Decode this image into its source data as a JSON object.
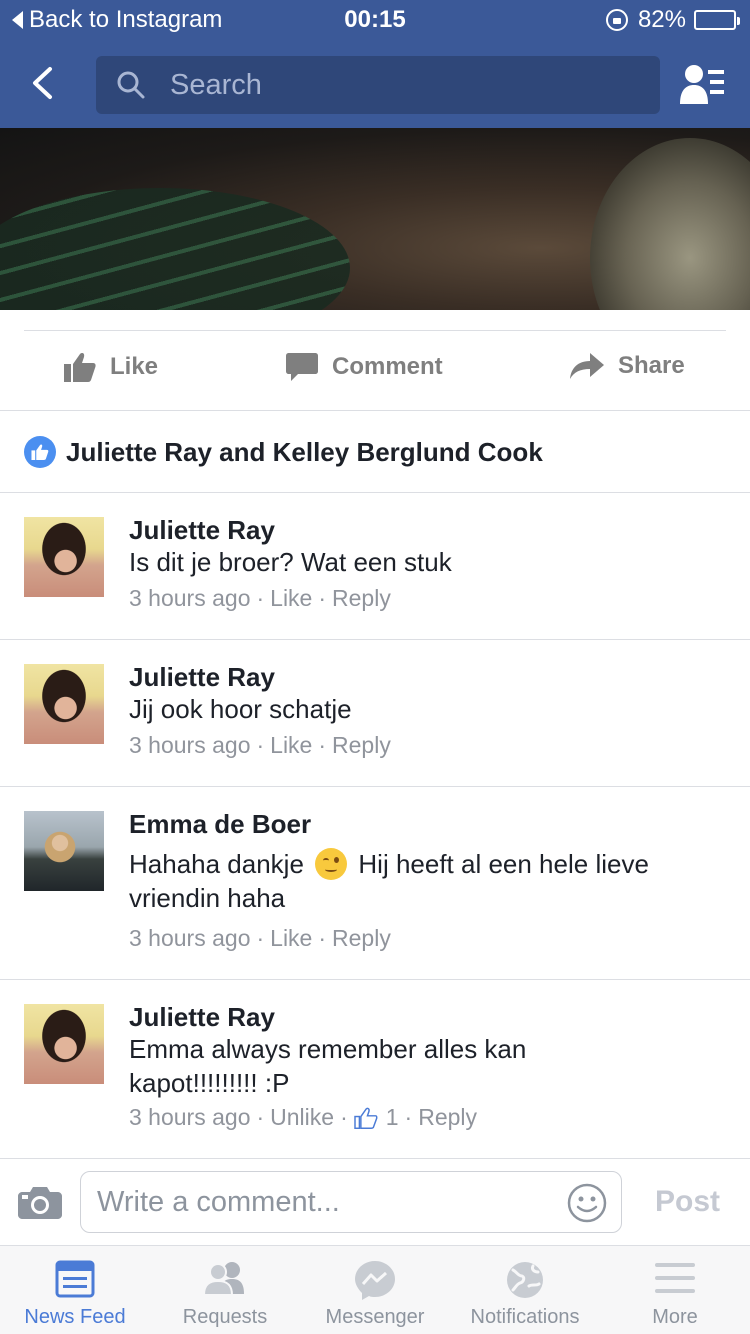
{
  "status_bar": {
    "back_label": "Back to Instagram",
    "time": "00:15",
    "battery": "82%",
    "battery_level": 0.82
  },
  "nav": {
    "search_placeholder": "Search"
  },
  "actions": {
    "like": "Like",
    "comment": "Comment",
    "share": "Share"
  },
  "likes_summary": "Juliette Ray and Kelley Berglund Cook",
  "comments": [
    {
      "name": "Juliette Ray",
      "text": "Is dit je broer? Wat een stuk",
      "time": "3 hours ago",
      "like": "Like",
      "reply": "Reply"
    },
    {
      "name": "Juliette Ray",
      "text": "Jij ook hoor schatje",
      "time": "3 hours ago",
      "like": "Like",
      "reply": "Reply"
    },
    {
      "name": "Emma de Boer",
      "text_before": "Hahaha dankje",
      "text_after": "Hij heeft al een hele lieve vriendin haha",
      "emoji": "winking-face",
      "time": "3 hours ago",
      "like": "Like",
      "reply": "Reply"
    },
    {
      "name": "Juliette Ray",
      "text": "Emma always remember alles kan kapot!!!!!!!!! :P",
      "time": "3 hours ago",
      "like": "Unlike",
      "like_count": "1",
      "reply": "Reply"
    }
  ],
  "composer": {
    "placeholder": "Write a comment...",
    "post_label": "Post"
  },
  "tabs": [
    {
      "label": "News Feed",
      "icon": "news-feed-icon",
      "active": true
    },
    {
      "label": "Requests",
      "icon": "friend-requests-icon"
    },
    {
      "label": "Messenger",
      "icon": "messenger-icon"
    },
    {
      "label": "Notifications",
      "icon": "globe-icon"
    },
    {
      "label": "More",
      "icon": "menu-icon"
    }
  ],
  "colors": {
    "brand": "#3b5998",
    "active_tab": "#4b7bd6",
    "muted": "#90949c"
  }
}
